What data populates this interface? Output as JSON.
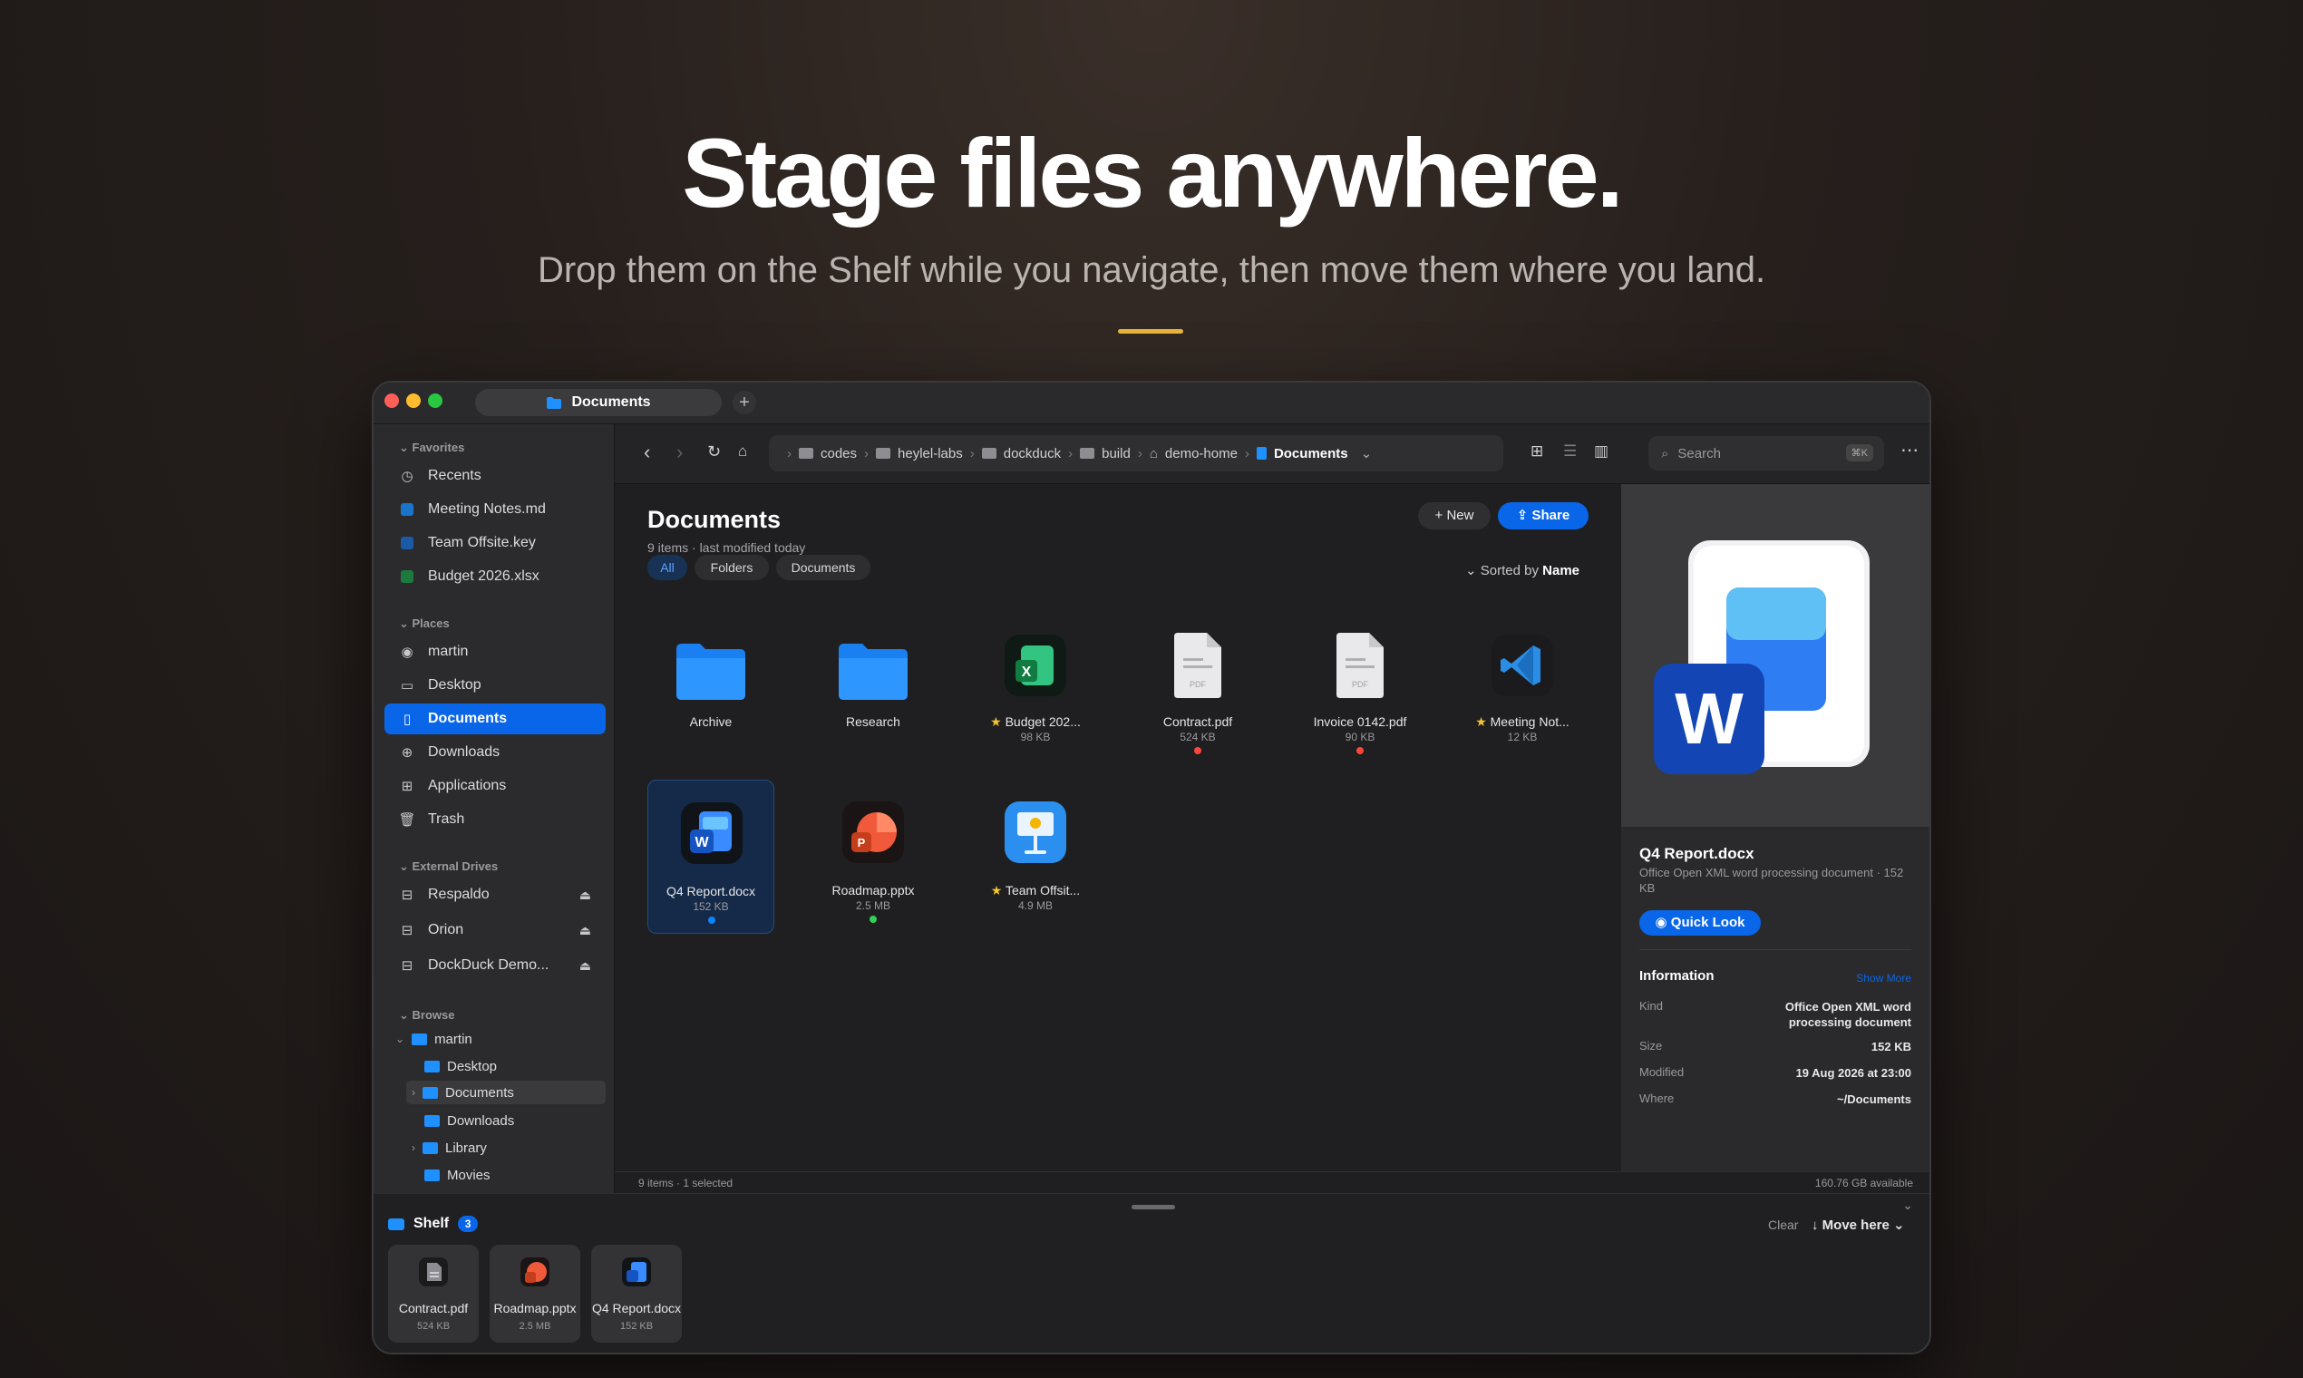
{
  "hero": {
    "title": "Stage files anywhere.",
    "subtitle": "Drop them on the Shelf while you navigate, then move them where you land."
  },
  "colors": {
    "accent": "#0a66e8",
    "hero_rule": "#e8b339",
    "close": "#ff5f57",
    "minimize": "#febc2e",
    "zoom": "#28c840"
  },
  "window": {
    "tab_title": "Documents"
  },
  "sidebar": {
    "favorites_header": "Favorites",
    "favorites": [
      {
        "label": "Recents",
        "icon": "clock-icon"
      },
      {
        "label": "Meeting Notes.md",
        "icon": "vscode-file-icon"
      },
      {
        "label": "Team Offsite.key",
        "icon": "keynote-file-icon"
      },
      {
        "label": "Budget 2026.xlsx",
        "icon": "excel-file-icon"
      }
    ],
    "places_header": "Places",
    "places": [
      {
        "label": "martin",
        "icon": "user-icon"
      },
      {
        "label": "Desktop",
        "icon": "desktop-icon"
      },
      {
        "label": "Documents",
        "icon": "document-icon"
      },
      {
        "label": "Downloads",
        "icon": "download-icon"
      },
      {
        "label": "Applications",
        "icon": "applications-icon"
      },
      {
        "label": "Trash",
        "icon": "trash-icon"
      }
    ],
    "external_header": "External Drives",
    "external": [
      {
        "label": "Respaldo"
      },
      {
        "label": "Orion"
      },
      {
        "label": "DockDuck Demo..."
      }
    ],
    "browse_header": "Browse",
    "browse": [
      {
        "label": "martin"
      },
      {
        "label": "Desktop"
      },
      {
        "label": "Documents"
      },
      {
        "label": "Downloads"
      },
      {
        "label": "Library"
      },
      {
        "label": "Movies"
      }
    ]
  },
  "toolbar": {
    "breadcrumbs": [
      "codes",
      "heylel-labs",
      "dockduck",
      "build",
      "demo-home",
      "Documents"
    ],
    "search_placeholder": "Search",
    "search_shortcut": "⌘K"
  },
  "content": {
    "title": "Documents",
    "meta": "9 items · last modified today",
    "filters": [
      "All",
      "Folders",
      "Documents"
    ],
    "new_label": "New",
    "share_label": "Share",
    "sort_prefix": "Sorted by",
    "sort_value": "Name",
    "files": [
      {
        "name": "Archive",
        "size": "",
        "icon": "folder-icon",
        "starred": false,
        "tag": ""
      },
      {
        "name": "Research",
        "size": "",
        "icon": "folder-icon",
        "starred": false,
        "tag": ""
      },
      {
        "name": "Budget 202...",
        "size": "98 KB",
        "icon": "excel-icon",
        "starred": true,
        "tag": ""
      },
      {
        "name": "Contract.pdf",
        "size": "524 KB",
        "icon": "pdf-icon",
        "starred": false,
        "tag": "#ff453a"
      },
      {
        "name": "Invoice 0142.pdf",
        "size": "90 KB",
        "icon": "pdf-icon",
        "starred": false,
        "tag": "#ff453a"
      },
      {
        "name": "Meeting Not...",
        "size": "12 KB",
        "icon": "vscode-icon",
        "starred": true,
        "tag": ""
      },
      {
        "name": "Q4 Report.docx",
        "size": "152 KB",
        "icon": "word-icon",
        "starred": false,
        "tag": "#0a84ff"
      },
      {
        "name": "Roadmap.pptx",
        "size": "2.5 MB",
        "icon": "powerpoint-icon",
        "starred": false,
        "tag": "#30d158"
      },
      {
        "name": "Team Offsit...",
        "size": "4.9 MB",
        "icon": "keynote-icon",
        "starred": true,
        "tag": ""
      }
    ]
  },
  "preview": {
    "name": "Q4 Report.docx",
    "kind_line": "Office Open XML word processing document · 152 KB",
    "quick_look_label": "Quick Look",
    "info_header": "Information",
    "show_more": "Show More",
    "rows": [
      {
        "key": "Kind",
        "value": "Office Open XML word processing document"
      },
      {
        "key": "Size",
        "value": "152 KB"
      },
      {
        "key": "Modified",
        "value": "19 Aug 2026 at 23:00"
      },
      {
        "key": "Where",
        "value": "~/Documents"
      }
    ]
  },
  "status": {
    "left": "9 items · 1 selected",
    "right": "160.76 GB available"
  },
  "shelf": {
    "label": "Shelf",
    "count": "3",
    "clear_label": "Clear",
    "move_label": "Move here",
    "items": [
      {
        "name": "Contract.pdf",
        "size": "524 KB"
      },
      {
        "name": "Roadmap.pptx",
        "size": "2.5 MB"
      },
      {
        "name": "Q4 Report.docx",
        "size": "152 KB"
      }
    ]
  }
}
